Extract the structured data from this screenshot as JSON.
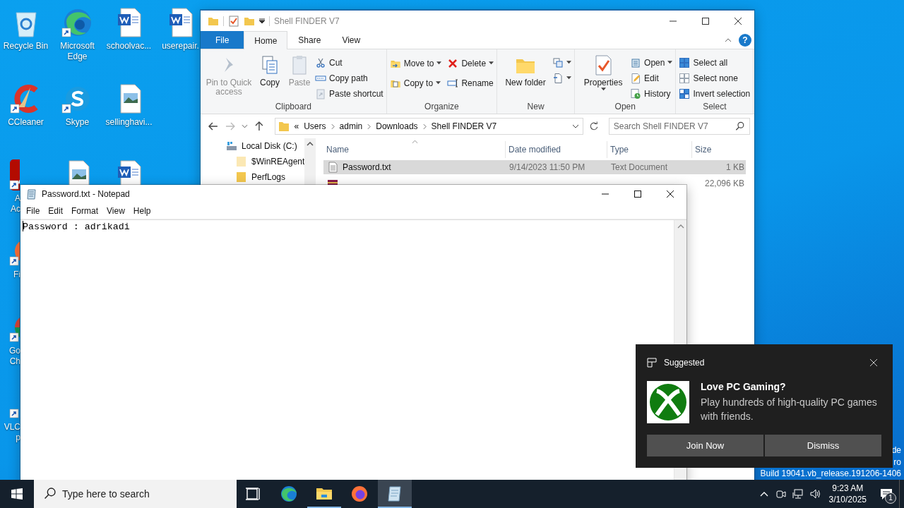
{
  "desktop": {
    "columns": [
      [
        {
          "kind": "recycle_bin",
          "label": "Recycle Bin",
          "shortcut": false,
          "covered": false
        },
        {
          "kind": "ccleaner",
          "label": "CCleaner",
          "shortcut": true,
          "covered": false
        },
        {
          "kind": "acrobat",
          "label": "A\nAc",
          "shortcut": true,
          "covered": true
        },
        {
          "kind": "firefox",
          "label": "Fi",
          "shortcut": true,
          "covered": true
        },
        {
          "kind": "chrome",
          "label": "Go\nCh",
          "shortcut": true,
          "covered": true
        },
        {
          "kind": "vlc",
          "label": "VLC\np",
          "shortcut": true,
          "covered": true
        }
      ],
      [
        {
          "kind": "edge",
          "label": "Microsoft Edge",
          "shortcut": true,
          "covered": false
        },
        {
          "kind": "skype",
          "label": "Skype",
          "shortcut": true,
          "covered": false
        },
        {
          "kind": "image_file",
          "shortcut": false,
          "covered": true
        }
      ],
      [
        {
          "kind": "word_doc",
          "label": "schoolvac...",
          "shortcut": false,
          "covered": false
        },
        {
          "kind": "image_file",
          "label": "sellinghavi...",
          "shortcut": false,
          "covered": false
        },
        {
          "kind": "word_doc",
          "shortcut": false,
          "covered": true
        }
      ],
      [
        {
          "kind": "word_doc",
          "label": "userepair.",
          "shortcut": false,
          "covered": false
        }
      ]
    ],
    "os_watermark": [
      "de",
      "ro",
      "Build 19041.vb_release.191206-1406"
    ]
  },
  "explorer": {
    "title": "Shell FINDER V7",
    "tabs": [
      {
        "label": "File",
        "kind": "file",
        "selected": false
      },
      {
        "label": "Home",
        "kind": "tab",
        "selected": true
      },
      {
        "label": "Share",
        "kind": "tab",
        "selected": false
      },
      {
        "label": "View",
        "kind": "tab",
        "selected": false
      }
    ],
    "help": "?",
    "ribbon": [
      {
        "label": "Clipboard",
        "buttons": [
          {
            "kind": "pin",
            "large": true,
            "label": "Pin to Quick access",
            "disabled": true,
            "dropdown": false
          },
          {
            "kind": "copy",
            "large": true,
            "label": "Copy",
            "disabled": false,
            "dropdown": false
          },
          {
            "kind": "paste",
            "large": true,
            "label": "Paste",
            "disabled": true,
            "dropdown": false
          },
          {
            "kind": "cut",
            "large": false,
            "label": "Cut",
            "disabled": false,
            "dropdown": false
          },
          {
            "kind": "copy_path",
            "large": false,
            "label": "Copy path",
            "disabled": false,
            "dropdown": false
          },
          {
            "kind": "paste_shortcut",
            "large": false,
            "label": "Paste shortcut",
            "disabled": true,
            "dropdown": false
          }
        ]
      },
      {
        "label": "Organize",
        "buttons": [
          {
            "kind": "move_to",
            "large": false,
            "label": "Move to",
            "disabled": false,
            "dropdown": true
          },
          {
            "kind": "copy_to",
            "large": false,
            "label": "Copy to",
            "disabled": false,
            "dropdown": true
          },
          {
            "kind": "delete",
            "large": false,
            "label": "Delete",
            "disabled": false,
            "dropdown": true
          },
          {
            "kind": "rename",
            "large": false,
            "label": "Rename",
            "disabled": false,
            "dropdown": false
          }
        ]
      },
      {
        "label": "New",
        "buttons": [
          {
            "kind": "new_folder",
            "large": true,
            "label": "New folder",
            "disabled": false,
            "dropdown": false
          },
          {
            "kind": "new_item",
            "large": false,
            "disabled": false,
            "dropdown": true
          },
          {
            "kind": "easy_access",
            "large": false,
            "disabled": false,
            "dropdown": true
          }
        ]
      },
      {
        "label": "Open",
        "buttons": [
          {
            "kind": "properties",
            "large": true,
            "label": "Properties",
            "disabled": false,
            "dropdown": true
          },
          {
            "kind": "open",
            "large": false,
            "label": "Open",
            "disabled": false,
            "dropdown": true
          },
          {
            "kind": "edit",
            "large": false,
            "label": "Edit",
            "disabled": false,
            "dropdown": false
          },
          {
            "kind": "history",
            "large": false,
            "label": "History",
            "disabled": false,
            "dropdown": false
          }
        ]
      },
      {
        "label": "Select",
        "buttons": [
          {
            "kind": "select_all",
            "large": false,
            "label": "Select all",
            "disabled": false,
            "dropdown": false
          },
          {
            "kind": "select_none",
            "large": false,
            "label": "Select none",
            "disabled": false,
            "dropdown": false
          },
          {
            "kind": "invert",
            "large": false,
            "label": "Invert selection",
            "disabled": false,
            "dropdown": false
          }
        ]
      }
    ],
    "address": {
      "overflow": "«",
      "path": [
        "Users",
        "admin",
        "Downloads",
        "Shell FINDER V7"
      ]
    },
    "search": {
      "placeholder": "Search Shell FINDER V7"
    },
    "nav_pane": [
      {
        "label": "Local Disk (C:)",
        "kind": "drive",
        "children": [
          {
            "label": "$WinREAgent",
            "kind": "hidden_folder"
          },
          {
            "label": "PerfLogs",
            "kind": "folder"
          }
        ]
      }
    ],
    "file_list": {
      "columns": [
        {
          "label": "Name",
          "sorted": true
        },
        {
          "label": "Date modified",
          "sorted": false
        },
        {
          "label": "Type",
          "sorted": false
        },
        {
          "label": "Size",
          "sorted": false
        }
      ],
      "rows": [
        {
          "kind": "text",
          "name": "Password.txt",
          "date": "9/14/2023 11:50 PM",
          "type": "Text Document",
          "size": "1 KB",
          "selected": true
        },
        {
          "kind": "exe",
          "size": "22,096 KB",
          "selected": false
        }
      ]
    }
  },
  "notepad": {
    "title": "Password.txt - Notepad",
    "menu": [
      "File",
      "Edit",
      "Format",
      "View",
      "Help"
    ],
    "content": "Password : adrikadi"
  },
  "notification": {
    "header": "Suggested",
    "title": "Love PC Gaming?",
    "body": "Play hundreds of high-quality PC games with friends.",
    "buttons": [
      "Join Now",
      "Dismiss"
    ]
  },
  "taskbar": {
    "search": {
      "placeholder": "Type here to search"
    },
    "apps": [
      {
        "kind": "task_view",
        "running": false,
        "selected": false
      },
      {
        "kind": "edge",
        "running": false,
        "selected": false
      },
      {
        "kind": "explorer",
        "running": true,
        "selected": false
      },
      {
        "kind": "firefox",
        "running": false,
        "selected": false
      },
      {
        "kind": "notepad",
        "running": true,
        "selected": true
      }
    ],
    "time": "9:23 AM",
    "date": "3/10/2025",
    "notification_count": "1"
  }
}
